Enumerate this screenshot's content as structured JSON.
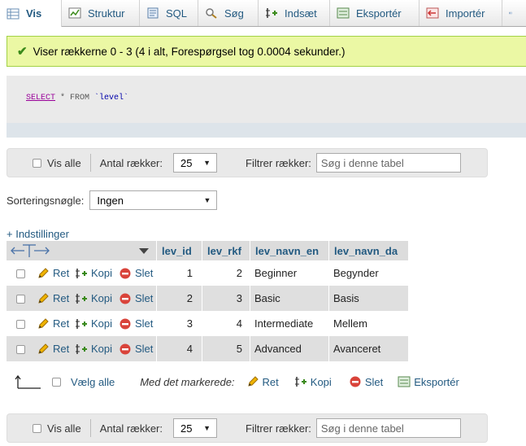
{
  "tabs": [
    {
      "label": "Vis",
      "icon": "browse-icon"
    },
    {
      "label": "Struktur",
      "icon": "structure-icon"
    },
    {
      "label": "SQL",
      "icon": "sql-icon"
    },
    {
      "label": "Søg",
      "icon": "search-icon"
    },
    {
      "label": "Indsæt",
      "icon": "insert-icon"
    },
    {
      "label": "Eksportér",
      "icon": "export-icon"
    },
    {
      "label": "Importér",
      "icon": "import-icon"
    }
  ],
  "success_message": "Viser rækkerne 0 - 3 (4 i alt, Forespørgsel tog 0.0004 sekunder.)",
  "sql": {
    "select": "SELECT",
    "rest": " * FROM ",
    "table": "`level`"
  },
  "nav": {
    "show_all": "Vis alle",
    "rows_label": "Antal rækker:",
    "rows_value": "25",
    "filter_label": "Filtrer rækker:",
    "filter_placeholder": "Søg i denne tabel"
  },
  "sort": {
    "label": "Sorteringsnøgle:",
    "value": "Ingen"
  },
  "settings_link": "+ Indstillinger",
  "columns": [
    "lev_id",
    "lev_rkf",
    "lev_navn_en",
    "lev_navn_da"
  ],
  "actions": {
    "edit": "Ret",
    "copy": "Kopi",
    "delete": "Slet"
  },
  "rows": [
    {
      "lev_id": "1",
      "lev_rkf": "2",
      "lev_navn_en": "Beginner",
      "lev_navn_da": "Begynder"
    },
    {
      "lev_id": "2",
      "lev_rkf": "3",
      "lev_navn_en": "Basic",
      "lev_navn_da": "Basis"
    },
    {
      "lev_id": "3",
      "lev_rkf": "4",
      "lev_navn_en": "Intermediate",
      "lev_navn_da": "Mellem"
    },
    {
      "lev_id": "4",
      "lev_rkf": "5",
      "lev_navn_en": "Advanced",
      "lev_navn_da": "Avanceret"
    }
  ],
  "bottom": {
    "select_all": "Vælg alle",
    "with_selected": "Med det markerede:",
    "edit": "Ret",
    "copy": "Kopi",
    "delete": "Slet",
    "export": "Eksportér"
  },
  "colors": {
    "link": "#235a81",
    "success_bg": "#ebf8a4",
    "row_alt": "#dfdfdf",
    "delete": "#d9433a"
  }
}
